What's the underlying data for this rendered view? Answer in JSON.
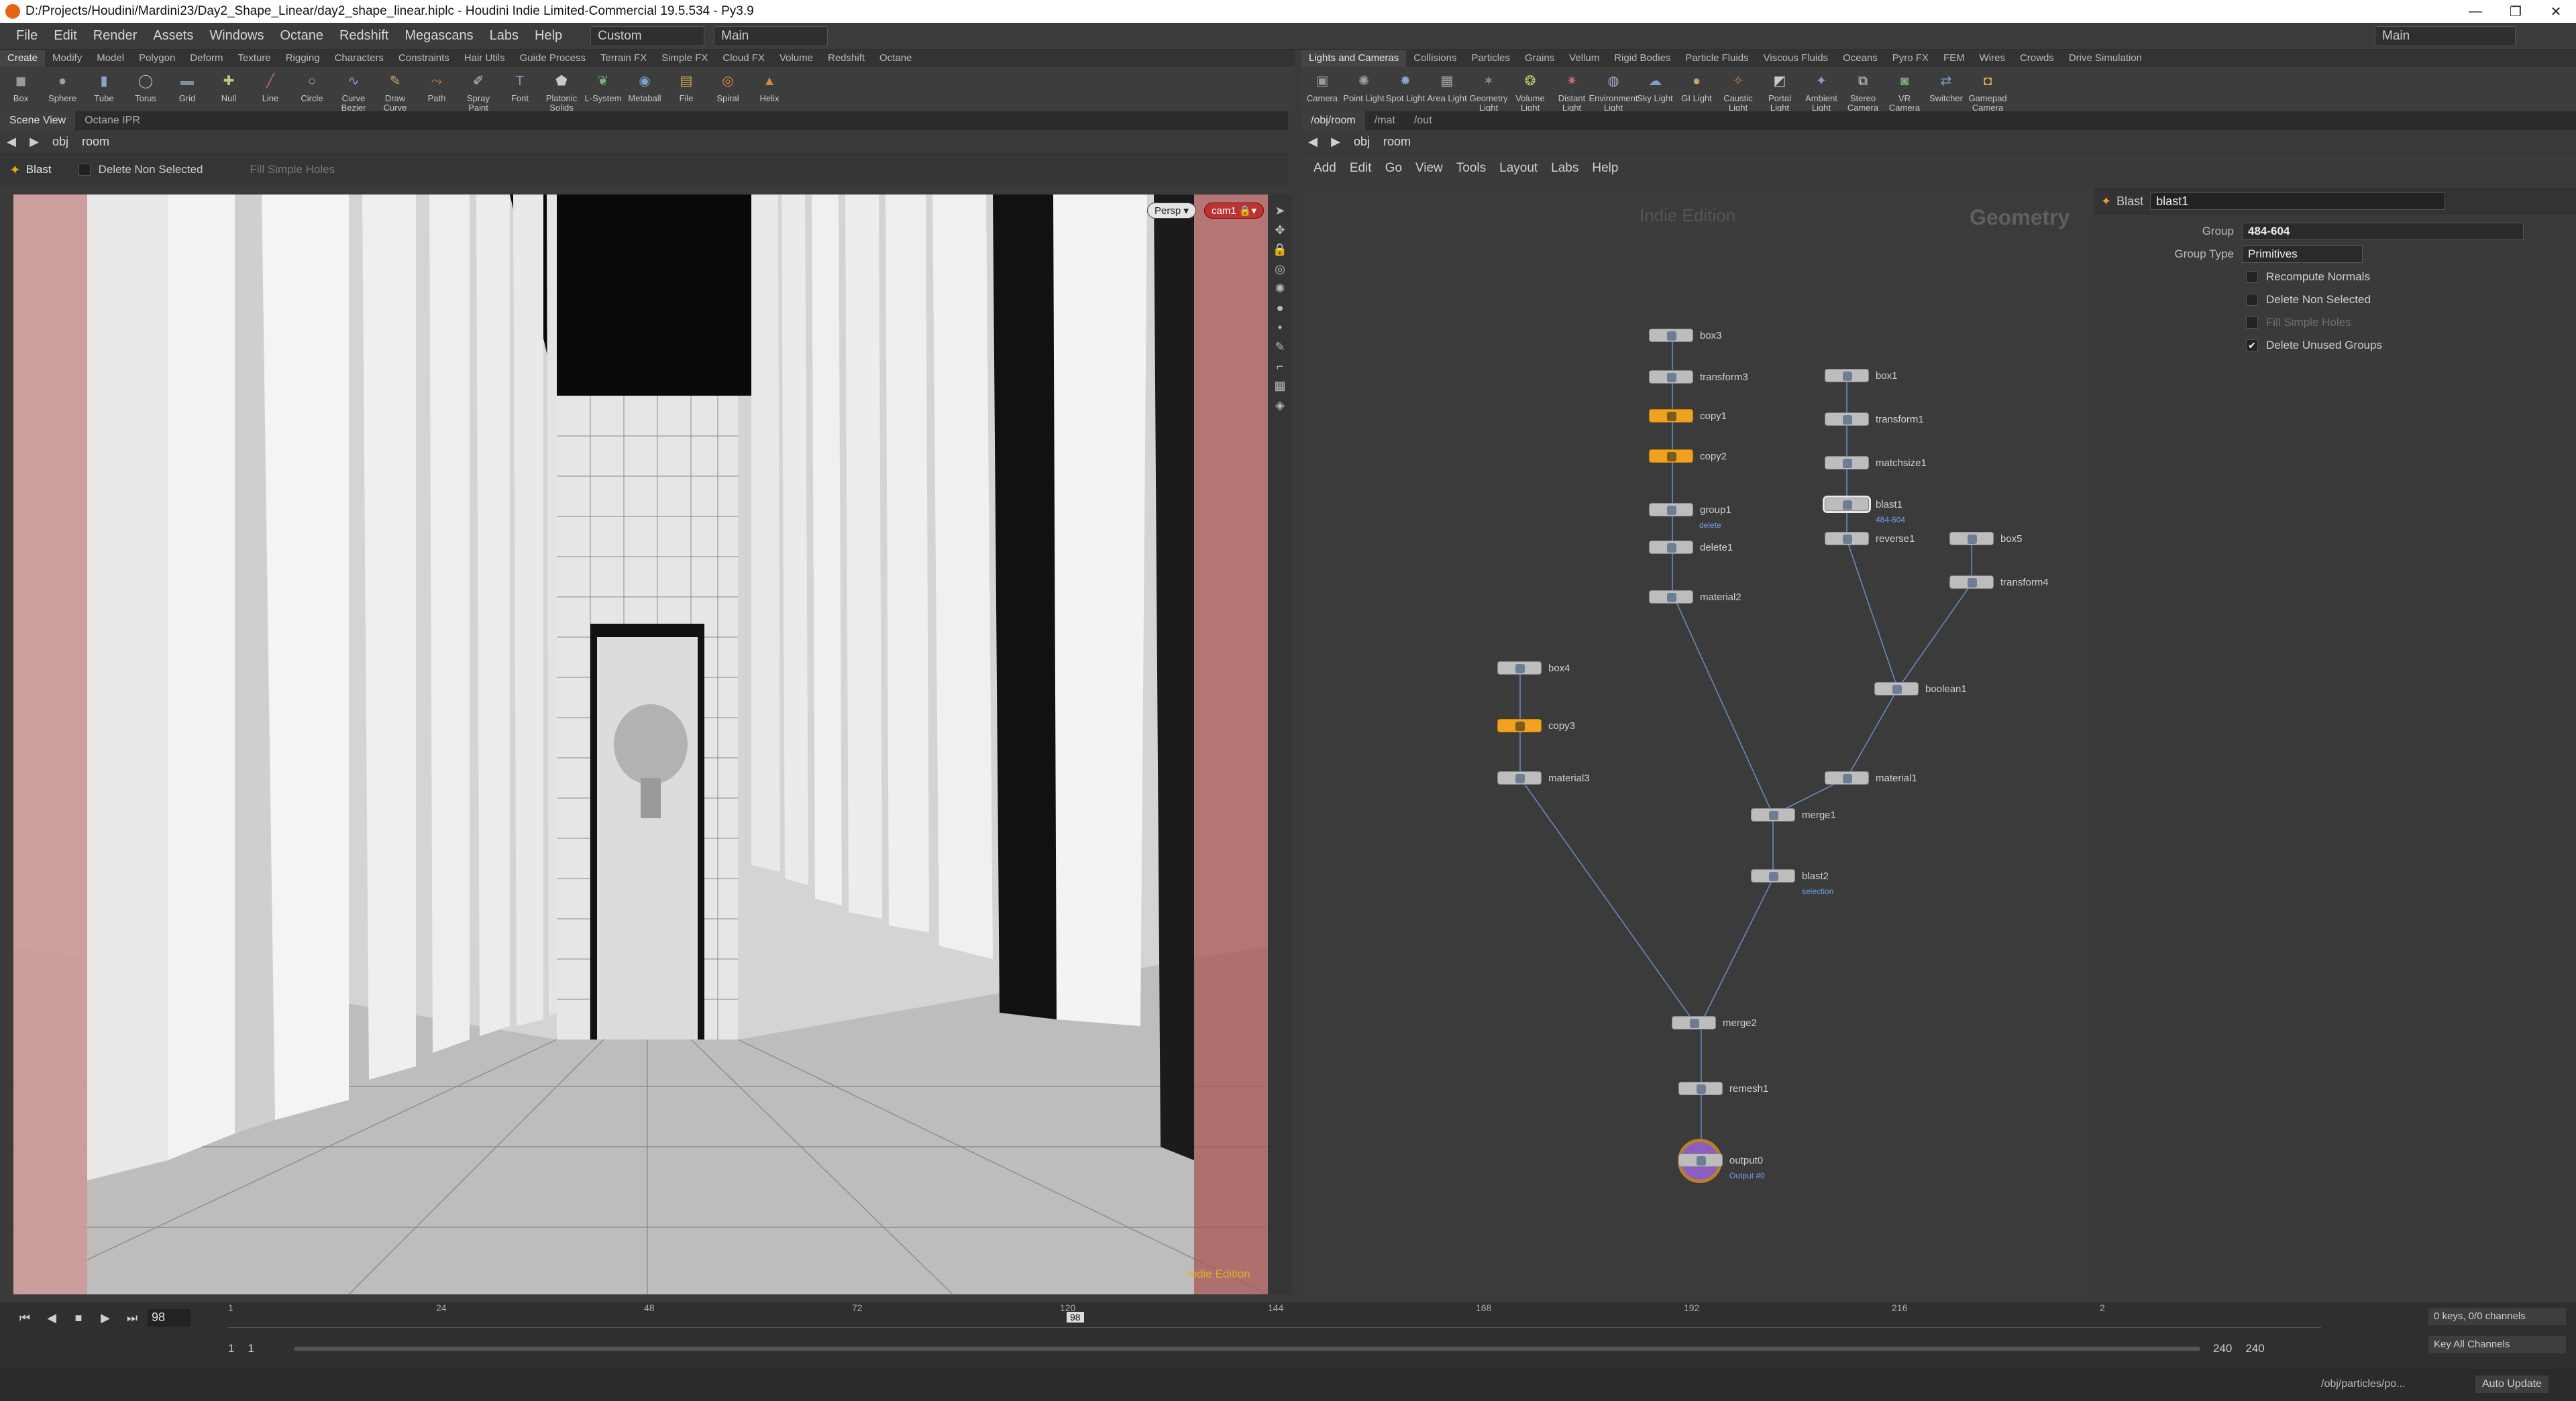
{
  "window": {
    "title": "D:/Projects/Houdini/Mardini23/Day2_Shape_Linear/day2_shape_linear.hiplc - Houdini Indie Limited-Commercial 19.5.534 - Py3.9",
    "minimize": "—",
    "maximize": "❐",
    "close": "✕"
  },
  "menu": {
    "items": [
      "File",
      "Edit",
      "Render",
      "Assets",
      "Windows",
      "Octane",
      "Redshift",
      "Megascans",
      "Labs",
      "Help"
    ],
    "desktop": "Custom",
    "main": "Main",
    "right_main": "Main"
  },
  "shelf_left": {
    "tabs": [
      "Create",
      "Modify",
      "Model",
      "Polygon",
      "Deform",
      "Texture",
      "Rigging",
      "Characters",
      "Constraints",
      "Hair Utils",
      "Guide Process",
      "Terrain FX",
      "Simple FX",
      "Cloud FX",
      "Volume",
      "Redshift",
      "Octane"
    ],
    "tools": [
      {
        "label": "Box",
        "icon": "◼"
      },
      {
        "label": "Sphere",
        "icon": "●"
      },
      {
        "label": "Tube",
        "icon": "▮"
      },
      {
        "label": "Torus",
        "icon": "◯"
      },
      {
        "label": "Grid",
        "icon": "▬"
      },
      {
        "label": "Null",
        "icon": "✚"
      },
      {
        "label": "Line",
        "icon": "╱"
      },
      {
        "label": "Circle",
        "icon": "○"
      },
      {
        "label": "Curve Bezier",
        "icon": "∿"
      },
      {
        "label": "Draw Curve",
        "icon": "✎"
      },
      {
        "label": "Path",
        "icon": "⤳"
      },
      {
        "label": "Spray Paint",
        "icon": "✐"
      },
      {
        "label": "Font",
        "icon": "T"
      },
      {
        "label": "Platonic Solids",
        "icon": "⬟"
      },
      {
        "label": "L-System",
        "icon": "❦"
      },
      {
        "label": "Metaball",
        "icon": "◉"
      },
      {
        "label": "File",
        "icon": "▤"
      },
      {
        "label": "Spiral",
        "icon": "◎"
      },
      {
        "label": "Helix",
        "icon": "▲"
      }
    ]
  },
  "shelf_right": {
    "tabs": [
      "Lights and Cameras",
      "Collisions",
      "Particles",
      "Grains",
      "Vellum",
      "Rigid Bodies",
      "Particle Fluids",
      "Viscous Fluids",
      "Oceans",
      "Pyro FX",
      "FEM",
      "Wires",
      "Crowds",
      "Drive Simulation"
    ],
    "tools": [
      {
        "label": "Camera",
        "icon": "▣"
      },
      {
        "label": "Point Light",
        "icon": "✺"
      },
      {
        "label": "Spot Light",
        "icon": "✹"
      },
      {
        "label": "Area Light",
        "icon": "▦"
      },
      {
        "label": "Geometry Light",
        "icon": "✶"
      },
      {
        "label": "Volume Light",
        "icon": "❂"
      },
      {
        "label": "Distant Light",
        "icon": "✷"
      },
      {
        "label": "Environment Light",
        "icon": "◍"
      },
      {
        "label": "Sky Light",
        "icon": "☁"
      },
      {
        "label": "GI Light",
        "icon": "●"
      },
      {
        "label": "Caustic Light",
        "icon": "✧"
      },
      {
        "label": "Portal Light",
        "icon": "◩"
      },
      {
        "label": "Ambient Light",
        "icon": "✦"
      },
      {
        "label": "Stereo Camera",
        "icon": "⧉"
      },
      {
        "label": "VR Camera",
        "icon": "◙"
      },
      {
        "label": "Switcher",
        "icon": "⇄"
      },
      {
        "label": "Gamepad Camera",
        "icon": "◘"
      }
    ]
  },
  "left_pane": {
    "tabs": [
      "Scene View",
      "Octane IPR"
    ],
    "path": [
      "obj",
      "room"
    ],
    "op_label": "Blast",
    "op_toggles": [
      "Delete Non Selected",
      "Fill Simple Holes"
    ],
    "persp": "Persp ▾",
    "cam": "cam1 🔒▾",
    "watermark": "Indie Edition"
  },
  "right_pane": {
    "tabs": [
      "/obj/room",
      "/mat",
      "/out"
    ],
    "path": [
      "obj",
      "room"
    ],
    "menu": [
      "Add",
      "Edit",
      "Go",
      "View",
      "Tools",
      "Layout",
      "Labs",
      "Help"
    ],
    "watermark": "Indie Edition",
    "context": "Geometry",
    "nodes": {
      "box3": "box3",
      "transform3": "transform3",
      "copy1": "copy1",
      "copy2": "copy2",
      "group1": "group1",
      "group1_sub": "delete",
      "delete1": "delete1",
      "material2": "material2",
      "box1": "box1",
      "transform1": "transform1",
      "matchsize1": "matchsize1",
      "blast1": "blast1",
      "blast1_sub": "484-604",
      "reverse1": "reverse1",
      "box5": "box5",
      "transform4": "transform4",
      "boolean1": "boolean1",
      "material1": "material1",
      "box4": "box4",
      "copy3": "copy3",
      "material3": "material3",
      "merge1": "merge1",
      "blast2": "blast2",
      "blast2_sub": "selection",
      "merge2": "merge2",
      "remesh1": "remesh1",
      "output0": "output0",
      "output0_sub": "Output #0"
    }
  },
  "params": {
    "type": "Blast",
    "name": "blast1",
    "group_label": "Group",
    "group_value": "484-604",
    "group_type_label": "Group Type",
    "group_type_value": "Primitives",
    "toggles": [
      {
        "label": "Recompute Normals",
        "checked": false
      },
      {
        "label": "Delete Non Selected",
        "checked": false
      },
      {
        "label": "Fill Simple Holes",
        "checked": false,
        "disabled": true
      },
      {
        "label": "Delete Unused Groups",
        "checked": true
      }
    ]
  },
  "timeline": {
    "current_frame": "98",
    "ticks": [
      "1",
      "24",
      "48",
      "72",
      "120",
      "144",
      "168",
      "192",
      "216",
      "2"
    ],
    "frame_marker": "98",
    "start": "1",
    "start2": "1",
    "end": "240",
    "end2": "240",
    "keys_info": "0 keys, 0/0 channels",
    "key_all": "Key All Channels"
  },
  "status": {
    "path": "/obj/particles/po...",
    "update": "Auto Update"
  }
}
